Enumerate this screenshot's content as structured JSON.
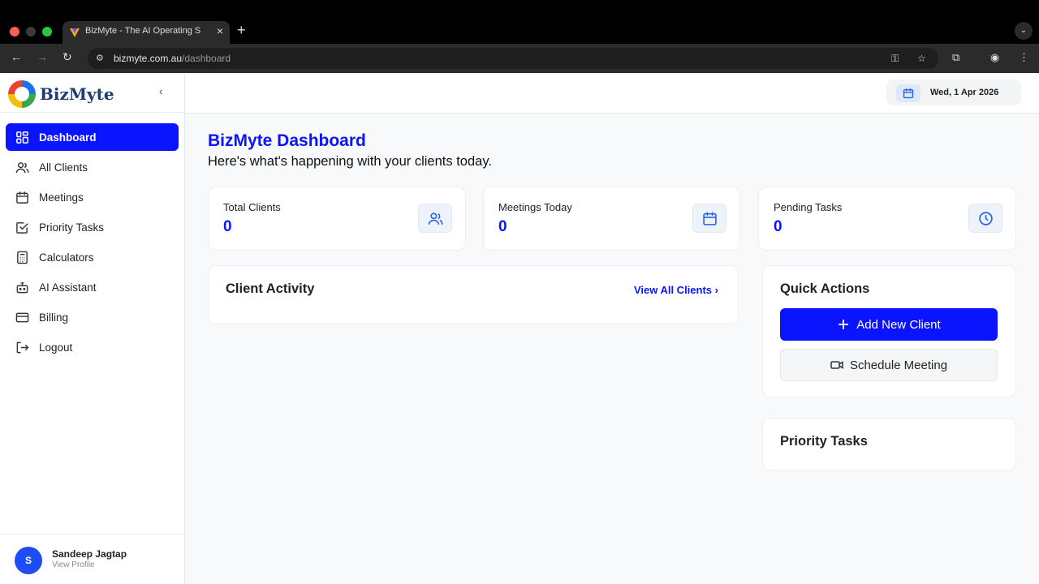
{
  "browser": {
    "tab_title": "BizMyte - The AI Operating S",
    "url_host": "bizmyte.com.au",
    "url_path": "/dashboard"
  },
  "sidebar": {
    "logo_text": "BizMyte",
    "items": [
      {
        "label": "Dashboard",
        "icon": "dashboard-grid-icon",
        "active": true
      },
      {
        "label": "All Clients",
        "icon": "users-icon"
      },
      {
        "label": "Meetings",
        "icon": "calendar-icon"
      },
      {
        "label": "Priority Tasks",
        "icon": "checkbox-icon"
      },
      {
        "label": "Calculators",
        "icon": "calculator-icon"
      },
      {
        "label": "AI Assistant",
        "icon": "robot-icon"
      },
      {
        "label": "Billing",
        "icon": "credit-card-icon"
      },
      {
        "label": "Logout",
        "icon": "logout-icon"
      }
    ],
    "user": {
      "initial": "S",
      "name": "Sandeep Jagtap",
      "sub": "View Profile"
    }
  },
  "topbar": {
    "date": "Wed, 1 Apr 2026"
  },
  "main": {
    "title": "BizMyte Dashboard",
    "subtitle": "Here's what's happening with your clients today.",
    "stats": [
      {
        "label": "Total Clients",
        "value": "0",
        "icon": "users-icon"
      },
      {
        "label": "Meetings Today",
        "value": "0",
        "icon": "calendar-icon"
      },
      {
        "label": "Pending Tasks",
        "value": "0",
        "icon": "clock-icon"
      }
    ],
    "client_activity": {
      "title": "Client Activity",
      "link": "View All Clients"
    },
    "quick_actions": {
      "title": "Quick Actions",
      "add_client": "Add New Client",
      "schedule": "Schedule Meeting"
    },
    "priority_tasks": {
      "title": "Priority Tasks"
    }
  },
  "colors": {
    "accent": "#0a14ff",
    "avatar": "#1d4ef5"
  }
}
